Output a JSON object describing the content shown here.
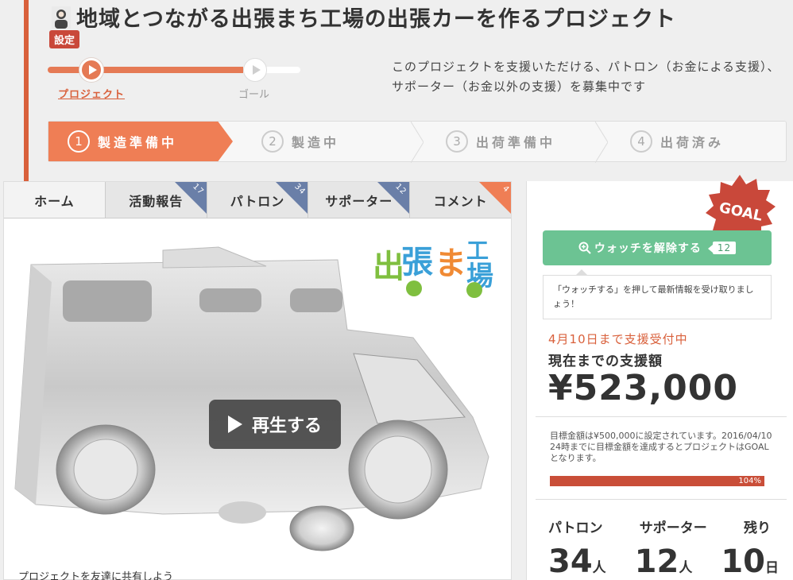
{
  "project": {
    "title": "地域とつながる出張まち工場の出張カーを作るプロジェクト",
    "setting_badge": "設定"
  },
  "progress": {
    "project_label": "プロジェクト",
    "goal_label": "ゴール"
  },
  "intro": "このプロジェクトを支援いただける、パトロン（お金による支援）、サポーター（お金以外の支援）を募集中です",
  "stages": [
    {
      "num": "1",
      "label": "製造準備中"
    },
    {
      "num": "2",
      "label": "製造中"
    },
    {
      "num": "3",
      "label": "出荷準備中"
    },
    {
      "num": "4",
      "label": "出荷済み"
    }
  ],
  "tabs": [
    {
      "label": "ホーム",
      "count": ""
    },
    {
      "label": "活動報告",
      "count": "17"
    },
    {
      "label": "パトロン",
      "count": "34"
    },
    {
      "label": "サポーター",
      "count": "12"
    },
    {
      "label": "コメント",
      "count": "4"
    }
  ],
  "video": {
    "play_label": "再生する",
    "logo_text": "出張まち工場"
  },
  "share_text": "プロジェクトを友達に共有しよう",
  "sidebar": {
    "goal_badge": "GOAL",
    "watch_button": "ウォッチを解除する",
    "watch_count": "12",
    "watch_note": "「ウォッチする」を押して最新情報を受け取りましょう！",
    "deadline": "4月10日まで支援受付中",
    "raised_label": "現在までの支援額",
    "raised_amount": "¥523,000",
    "goal_note": "目標金額は¥500,000に設定されています。2016/04/10 24時までに目標金額を達成するとプロジェクトはGOALとなります。",
    "ratio_label": "104%",
    "stats": {
      "patron_label": "パトロン",
      "supporter_label": "サポーター",
      "remaining_label": "残り",
      "patron_value": "34",
      "patron_unit": "人",
      "supporter_value": "12",
      "supporter_unit": "人",
      "remaining_value": "10",
      "remaining_unit": "日"
    }
  },
  "colors": {
    "accent": "#d9603b",
    "stage_active": "#ef7e55",
    "watch_green": "#6cc393",
    "goal_red": "#c9483a",
    "tab_corner_blue": "#6a7fa8"
  }
}
